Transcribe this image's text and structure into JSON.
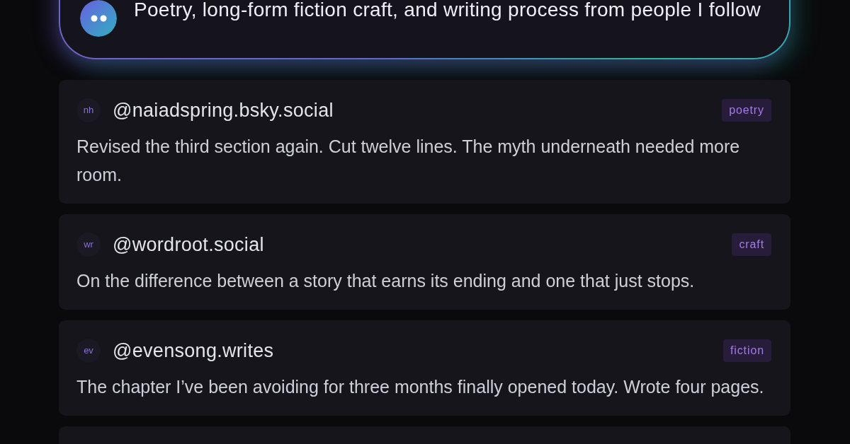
{
  "header": {
    "description": "Poetry, long-form fiction craft, and writing process from people I follow"
  },
  "posts": [
    {
      "initials": "nh",
      "handle": "@naiadspring.bsky.social",
      "tag": "poetry",
      "text": "Revised the third section again. Cut twelve lines. The myth underneath needed more room."
    },
    {
      "initials": "wr",
      "handle": "@wordroot.social",
      "tag": "craft",
      "text": "On the difference between a story that earns its ending and one that just stops."
    },
    {
      "initials": "ev",
      "handle": "@evensong.writes",
      "tag": "fiction",
      "text": "The chapter I’ve been avoiding for three months finally opened today. Wrote four pages."
    }
  ]
}
